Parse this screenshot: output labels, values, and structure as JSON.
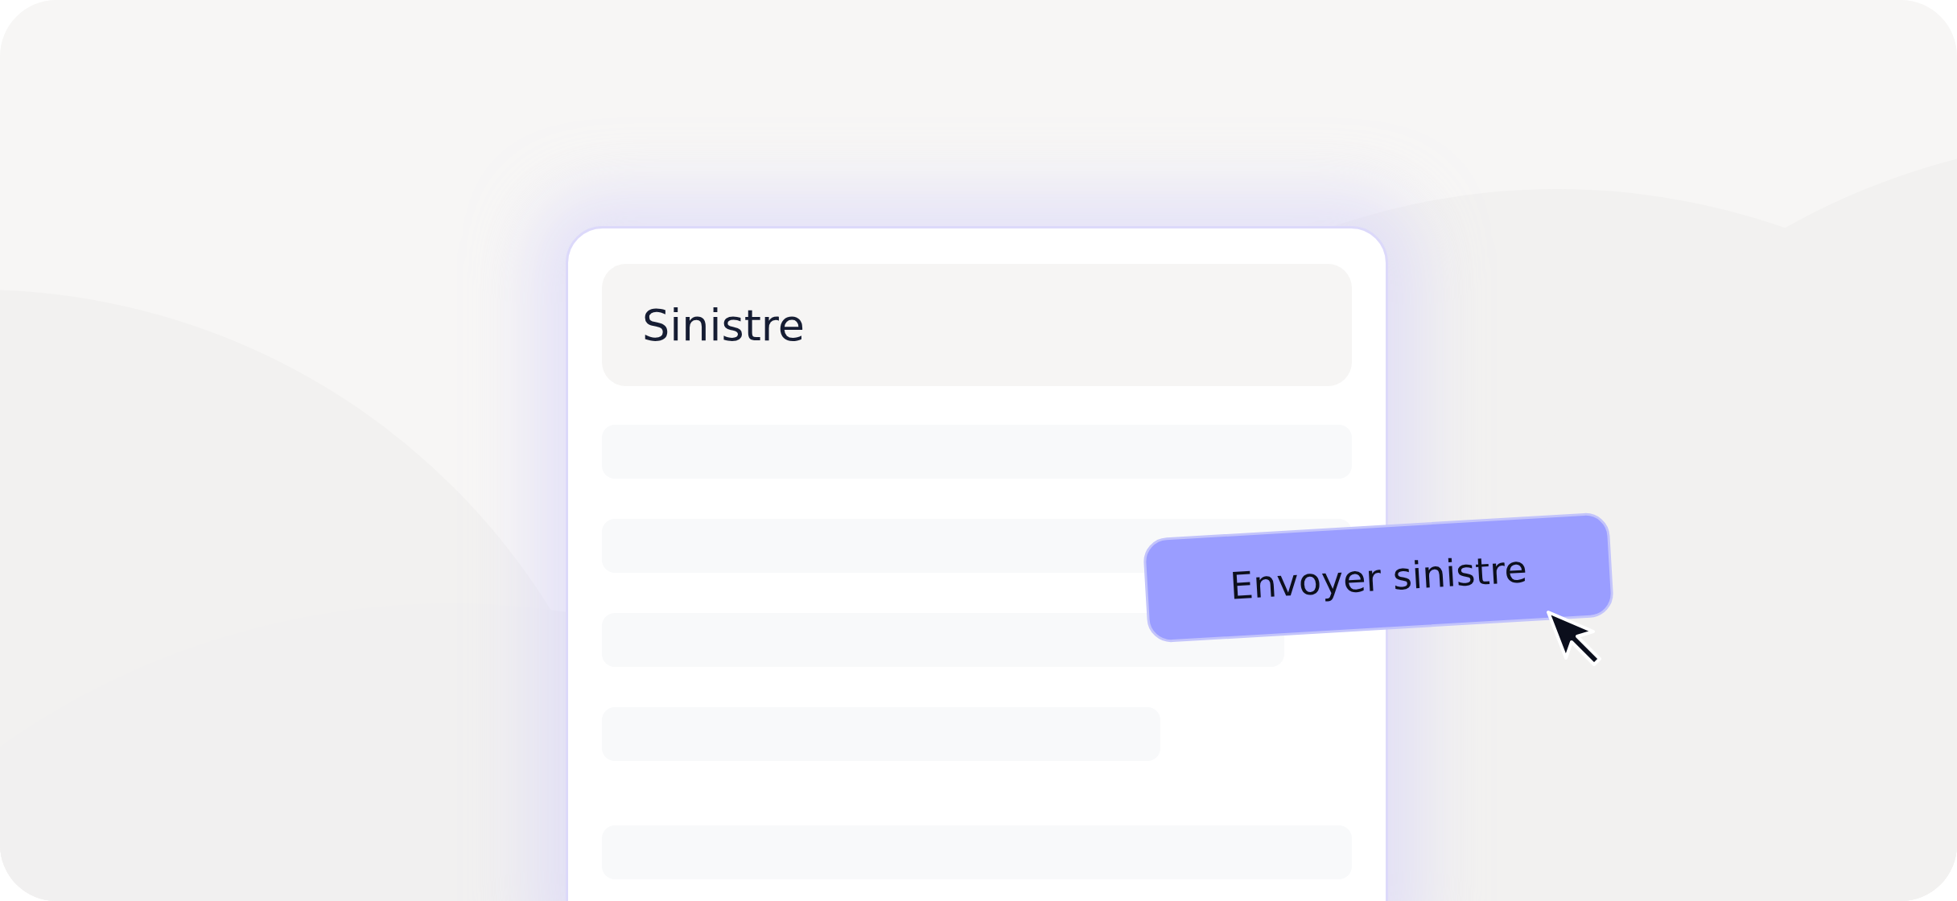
{
  "form": {
    "title": "Sinistre",
    "skeleton_lines": [
      {
        "kind": "full"
      },
      {
        "kind": "full"
      },
      {
        "kind": "long"
      },
      {
        "kind": "medium"
      },
      {
        "kind": "footer"
      }
    ]
  },
  "action_button": {
    "label": "Envoyer sinistre"
  }
}
